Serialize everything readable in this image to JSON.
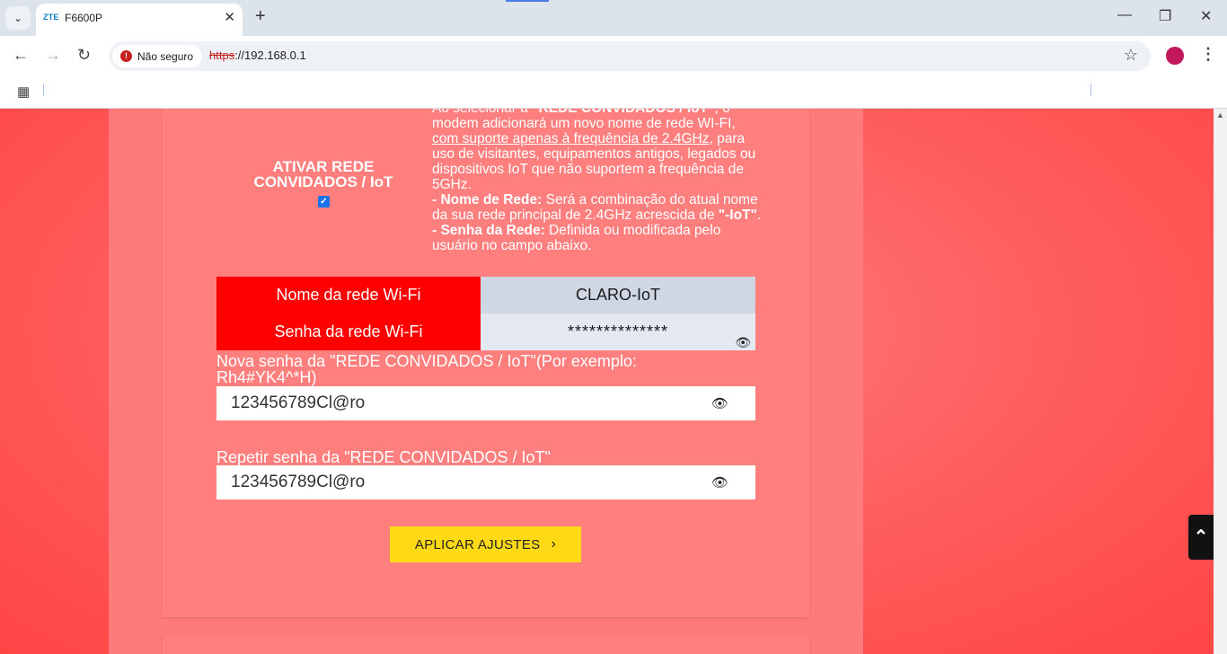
{
  "browser": {
    "tab": {
      "favicon_text": "ZTE",
      "title": "F6600P"
    },
    "security_label": "Não seguro",
    "url_scheme": "https",
    "url_rest": "://192.168.0.1"
  },
  "page": {
    "iot_toggle": {
      "label": "ATIVAR REDE CONVIDADOS / IoT",
      "checked": true
    },
    "info": {
      "p1_start": "Ao selecionar a ",
      "p1_bold": "\"REDE CONVIDADOS / IoT\"",
      "p1_mid": ", o modem adicionará um novo nome de rede WI-FI, ",
      "p1_underline": "com suporte apenas à frequência de 2.4GHz",
      "p1_end": ", para uso de visitantes, equipamentos antigos, legados ou dispositivos IoT que não suportem a frequência de 5GHz.",
      "p2_bold": "- Nome de Rede:",
      "p2_text": " Será a combinação do atual nome da sua rede principal de 2.4GHz acrescida de ",
      "p2_bold2": "\"-IoT\"",
      "p2_end": ".",
      "p3_bold": "- Senha da Rede:",
      "p3_text": " Definida ou modificada pelo usuário no campo abaixo."
    },
    "wifi_table": [
      {
        "label": "Nome da rede Wi-Fi",
        "value": "CLARO-IoT"
      },
      {
        "label": "Senha da rede Wi-Fi",
        "value": "**************"
      }
    ],
    "new_password": {
      "label": "Nova senha da \"REDE CONVIDADOS / IoT\"(Por exemplo: Rh4#YK4^*H)",
      "value": "123456789Cl@ro"
    },
    "repeat_password": {
      "label": "Repetir senha da \"REDE CONVIDADOS / IoT\"",
      "value": "123456789Cl@ro"
    },
    "apply_button": "APLICAR AJUSTES"
  },
  "colors": {
    "accent_red": "#ff0000",
    "button_yellow": "#fdd916",
    "page_bg": "#ff7f7f"
  }
}
